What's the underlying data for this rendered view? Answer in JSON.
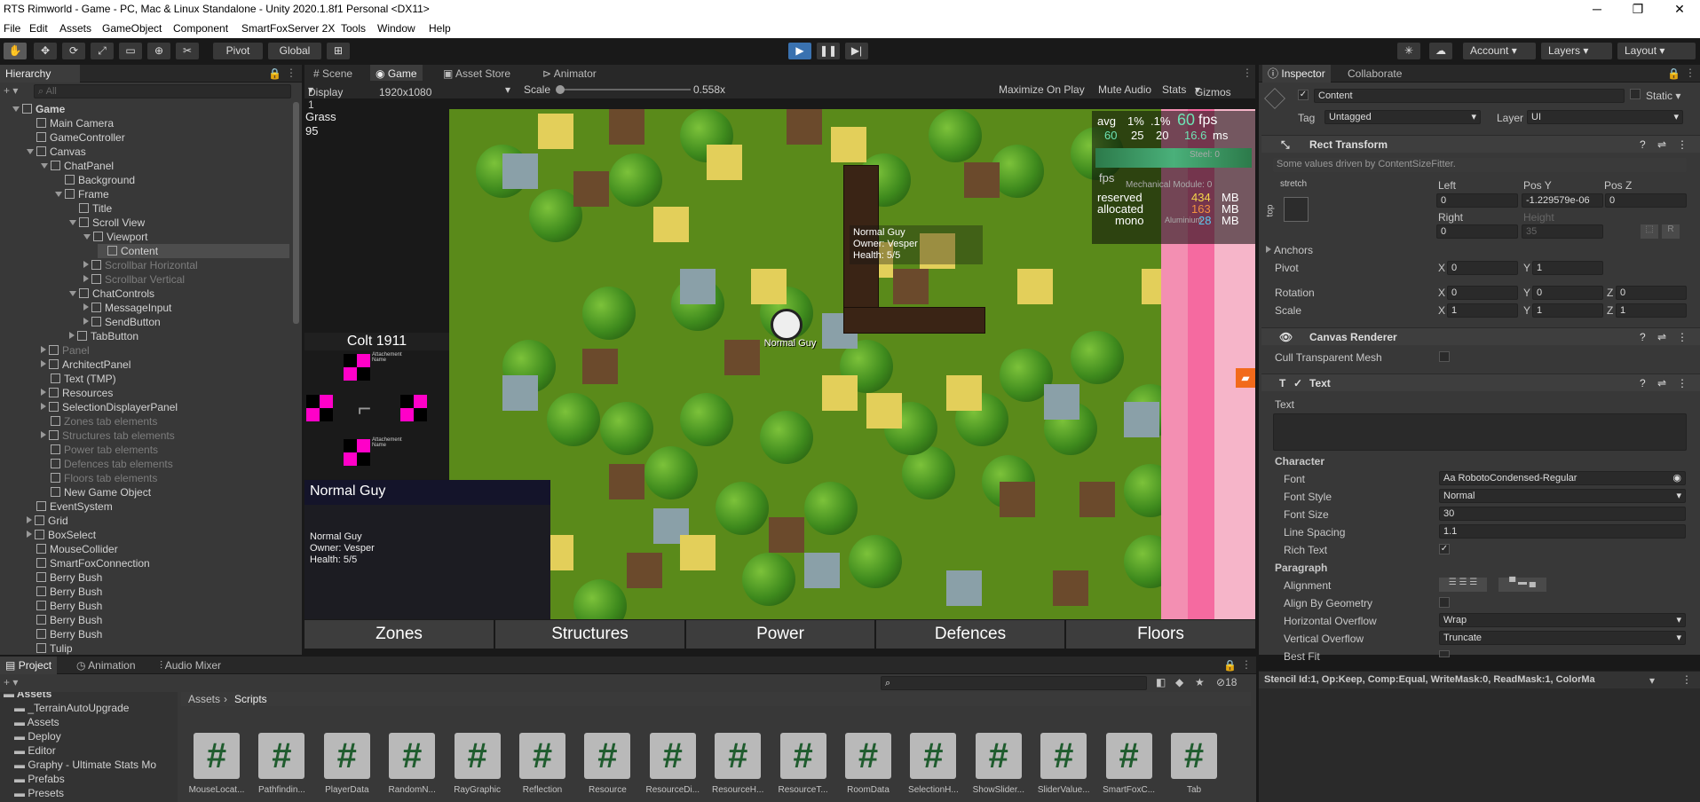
{
  "window": {
    "title": "RTS Rimworld - Game - PC, Mac & Linux Standalone - Unity 2020.1.8f1 Personal <DX11>",
    "minimize": "─",
    "maximize": "❐",
    "close": "✕"
  },
  "menu": [
    "File",
    "Edit",
    "Assets",
    "GameObject",
    "Component",
    "SmartFoxServer 2X",
    "Tools",
    "Window",
    "Help"
  ],
  "toolbar": {
    "pivot": "Pivot",
    "global": "Global",
    "account": "Account",
    "layers": "Layers",
    "layout": "Layout"
  },
  "hierarchy": {
    "tab": "Hierarchy",
    "search_placeholder": "All",
    "items": [
      {
        "label": "Game",
        "indent": 0,
        "expanded": true,
        "scene": true
      },
      {
        "label": "Main Camera",
        "indent": 1
      },
      {
        "label": "GameController",
        "indent": 1
      },
      {
        "label": "Canvas",
        "indent": 1,
        "expanded": true
      },
      {
        "label": "ChatPanel",
        "indent": 2,
        "expanded": true
      },
      {
        "label": "Background",
        "indent": 3
      },
      {
        "label": "Frame",
        "indent": 3,
        "expanded": true
      },
      {
        "label": "Title",
        "indent": 4
      },
      {
        "label": "Scroll View",
        "indent": 4,
        "expanded": true
      },
      {
        "label": "Viewport",
        "indent": 5,
        "expanded": true
      },
      {
        "label": "Content",
        "indent": 6,
        "selected": true
      },
      {
        "label": "Scrollbar Horizontal",
        "indent": 5,
        "dim": true,
        "collapsed": true
      },
      {
        "label": "Scrollbar Vertical",
        "indent": 5,
        "dim": true,
        "collapsed": true
      },
      {
        "label": "ChatControls",
        "indent": 4,
        "expanded": true
      },
      {
        "label": "MessageInput",
        "indent": 5,
        "collapsed": true
      },
      {
        "label": "SendButton",
        "indent": 5,
        "collapsed": true
      },
      {
        "label": "TabButton",
        "indent": 4,
        "collapsed": true
      },
      {
        "label": "Panel",
        "indent": 2,
        "dim": true,
        "collapsed": true
      },
      {
        "label": "ArchitectPanel",
        "indent": 2,
        "collapsed": true
      },
      {
        "label": "Text (TMP)",
        "indent": 2
      },
      {
        "label": "Resources",
        "indent": 2,
        "collapsed": true
      },
      {
        "label": "SelectionDisplayerPanel",
        "indent": 2,
        "collapsed": true
      },
      {
        "label": "Zones tab elements",
        "indent": 2,
        "dim": true
      },
      {
        "label": "Structures tab elements",
        "indent": 2,
        "dim": true,
        "collapsed": true
      },
      {
        "label": "Power tab elements",
        "indent": 2,
        "dim": true
      },
      {
        "label": "Defences tab elements",
        "indent": 2,
        "dim": true
      },
      {
        "label": "Floors tab elements",
        "indent": 2,
        "dim": true
      },
      {
        "label": "New Game Object",
        "indent": 2
      },
      {
        "label": "EventSystem",
        "indent": 1
      },
      {
        "label": "Grid",
        "indent": 1,
        "collapsed": true
      },
      {
        "label": "BoxSelect",
        "indent": 1,
        "collapsed": true
      },
      {
        "label": "MouseCollider",
        "indent": 1
      },
      {
        "label": "SmartFoxConnection",
        "indent": 1
      },
      {
        "label": "Berry Bush",
        "indent": 1
      },
      {
        "label": "Berry Bush",
        "indent": 1
      },
      {
        "label": "Berry Bush",
        "indent": 1
      },
      {
        "label": "Berry Bush",
        "indent": 1
      },
      {
        "label": "Berry Bush",
        "indent": 1
      },
      {
        "label": "Tulip",
        "indent": 1
      }
    ]
  },
  "view_tabs": [
    "Scene",
    "Game",
    "Asset Store",
    "Animator"
  ],
  "game_toolbar": {
    "display": "Display 1",
    "resolution": "1920x1080",
    "scale_label": "Scale",
    "scale_value": "0.558x",
    "maximize": "Maximize On Play",
    "mute": "Mute Audio",
    "stats": "Stats",
    "gizmos": "Gizmos"
  },
  "game": {
    "tile_label": "Grass",
    "tile_value": "95",
    "weapon_name": "Colt 1911",
    "attachment": "Attachement Name",
    "stats": {
      "avg": "avg",
      "p1": "1%",
      "p01": ".1%",
      "fps": "60",
      "fps_unit": "fps",
      "ms": "16.6",
      "ms_unit": "ms",
      "avg_v": "60",
      "p1_v": "25",
      "p01_v": "20",
      "fps_lbl": "fps",
      "reserved": "reserved",
      "allocated": "allocated",
      "mono": "mono",
      "reserved_v": "434",
      "allocated_v": "163",
      "mono_v": "28",
      "mb": "MB",
      "steel": "Steel: 0",
      "mech": "Mechanical Module: 0",
      "alu": "Aluminium"
    },
    "tooltip": [
      "Normal Guy",
      "Owner: Vesper",
      "Health: 5/5"
    ],
    "unit_label": "Normal Guy",
    "sel_title": "Normal Guy",
    "sel_lines": [
      "Normal Guy",
      "Owner: Vesper",
      "Health: 5/5"
    ],
    "tabs": [
      "Zones",
      "Structures",
      "Power",
      "Defences",
      "Floors"
    ]
  },
  "inspector": {
    "tab": "Inspector",
    "tab2": "Collaborate",
    "name": "Content",
    "static": "Static",
    "tag_label": "Tag",
    "tag": "Untagged",
    "layer_label": "Layer",
    "layer": "UI",
    "rect": {
      "title": "Rect Transform",
      "note": "Some values driven by ContentSizeFitter.",
      "stretch": "stretch",
      "top": "top",
      "left_lbl": "Left",
      "posy_lbl": "Pos Y",
      "posz_lbl": "Pos Z",
      "left": "0",
      "posy": "-1.229579e-06",
      "posz": "0",
      "right_lbl": "Right",
      "height_lbl": "Height",
      "right": "0",
      "height": "35",
      "anchors": "Anchors",
      "pivot": "Pivot",
      "pivot_x": "0",
      "pivot_y": "1",
      "rotation": "Rotation",
      "rx": "0",
      "ry": "0",
      "rz": "0",
      "scale": "Scale",
      "sx": "1",
      "sy": "1",
      "sz": "1",
      "x": "X",
      "y": "Y",
      "z": "Z"
    },
    "canvas_renderer": {
      "title": "Canvas Renderer",
      "cull": "Cull Transparent Mesh"
    },
    "text": {
      "title": "Text",
      "text_lbl": "Text",
      "character": "Character",
      "font_lbl": "Font",
      "font": "RobotoCondensed-Regular",
      "style_lbl": "Font Style",
      "style": "Normal",
      "size_lbl": "Font Size",
      "size": "30",
      "spacing_lbl": "Line Spacing",
      "spacing": "1.1",
      "rich_lbl": "Rich Text",
      "paragraph": "Paragraph",
      "align_lbl": "Alignment",
      "geom_lbl": "Align By Geometry",
      "hover_lbl": "Horizontal Overflow",
      "hover": "Wrap",
      "vover_lbl": "Vertical Overflow",
      "vover": "Truncate",
      "best_lbl": "Best Fit"
    },
    "stencil": "Stencil Id:1, Op:Keep, Comp:Equal, WriteMask:0, ReadMask:1, ColorMa"
  },
  "project": {
    "tabs": [
      "Project",
      "Animation",
      "Audio Mixer"
    ],
    "count": "18",
    "breadcrumb": [
      "Assets",
      "Scripts"
    ],
    "tree": [
      "Assets",
      "_TerrainAutoUpgrade",
      "Assets",
      "Deploy",
      "Editor",
      "Graphy - Ultimate Stats Mo",
      "Prefabs",
      "Presets"
    ],
    "scripts": [
      "MouseLocat...",
      "Pathfindin...",
      "PlayerData",
      "RandomN...",
      "RayGraphic",
      "Reflection",
      "Resource",
      "ResourceDi...",
      "ResourceH...",
      "ResourceT...",
      "RoomData",
      "SelectionH...",
      "ShowSlider...",
      "SliderValue...",
      "SmartFoxC...",
      "Tab"
    ]
  }
}
